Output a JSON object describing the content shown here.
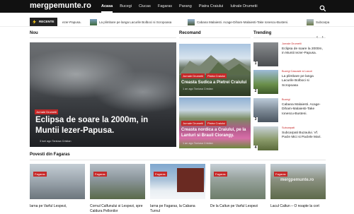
{
  "header": {
    "logo": "mergpemunte.ro",
    "nav": [
      "Acasa",
      "Bucegi",
      "Ciucas",
      "Fagaras",
      "Parang",
      "Piatra Craiului",
      "Iulnale Drumetii"
    ],
    "active_nav": "Acasa"
  },
  "ticker": {
    "label": "RECENTE",
    "items": [
      "ezer-Papusa.",
      "La plimbare pe langa Lacurile Bolboci si Scropoasa",
      "Cabana Malaiesti. Acage-Diham-Malaiesti-Take Ionescu-Busteni.",
      "Subcarpa"
    ]
  },
  "sections": {
    "nou": "Nou",
    "recomand": "Recomand",
    "trending": "Trending",
    "povesti": "Povesti din Fagaras"
  },
  "hero": {
    "category": "Jurnale Drumetii",
    "title": "Eclipsa de soare la 2000m, in Muntii Iezer-Papusa.",
    "meta": "3 luni ago   Taniusa Cristian"
  },
  "recommended": [
    {
      "cats": [
        "Jurnale Drumetii",
        "Piatra Craiului"
      ],
      "title": "Creasta Sudica a Pietrei Craiului",
      "meta": "1 an ago   Taniusa Cristian"
    },
    {
      "cats": [
        "Jurnale Drumetii",
        "Piatra Craiului"
      ],
      "title": "Creasta nordica a Craiului, pe la Lanturi si Brauil Ciorangy.",
      "meta": "1 an ago   Taniusa Cristian"
    }
  ],
  "trending": [
    {
      "num": "1",
      "cat": "Jurnale Drumetii",
      "text": "Eclipsa de soare la 2000m, in Muntii Iezer-Papusa."
    },
    {
      "num": "2",
      "cat": "Bucegi  Cascade si Lacuri",
      "text": "La plimbare pe langa Lacurile Bolboci si Scropoasa"
    },
    {
      "num": "3",
      "cat": "Bucegi",
      "text": "Cabana Malaiesti. Acage-Diham-Malaiesti-Take Ionescu-Busteni."
    },
    {
      "num": "4",
      "cat": "Subcarpati",
      "text": "Subcarpati Buzaului. Vf. Pacle Mici si Paclele Mari."
    }
  ],
  "cards": [
    {
      "badge": "Fagaras",
      "title": "Iarna pe Varful Lespezi,"
    },
    {
      "badge": "Fagaras",
      "title": "Cornul Calfunului si Lespezi, spre Caldura Pellonilor"
    },
    {
      "badge": "Fagaras",
      "title": "Iarna pe Fagaras, la Cabana Turnul"
    },
    {
      "badge": "Fagaras",
      "title": "De la Caltun pe Varful Lespezi"
    },
    {
      "badge": "Fagaras",
      "title": "Lacul Caltun – O noapte la cort"
    }
  ],
  "card_watermark": "mergpemunte.ro",
  "colors": {
    "accent": "#c62828",
    "topbar": "#111111"
  }
}
